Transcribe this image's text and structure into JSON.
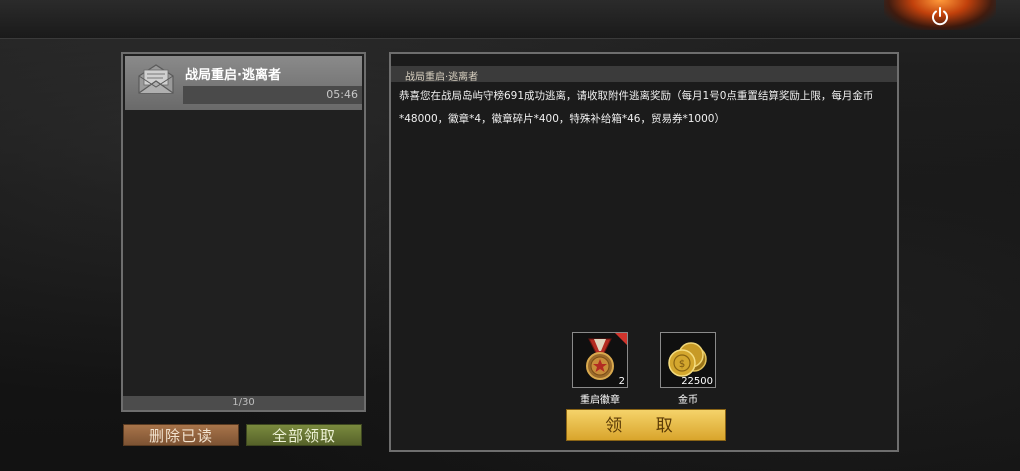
{
  "mail_list": {
    "items": [
      {
        "title": "战局重启·逃离者",
        "time": "05:46"
      }
    ],
    "page_indicator": "1/30"
  },
  "buttons": {
    "delete_read": "删除已读",
    "claim_all": "全部领取",
    "claim": "领 取"
  },
  "detail": {
    "title": "战局重启·逃离者",
    "body": "恭喜您在战局岛屿守榜691成功逃离，请收取附件逃离奖励（每月1号0点重置结算奖励上限，每月金币*48000，徽章*4，徽章碎片*400，特殊补给箱*46，贸易券*1000）",
    "rewards": [
      {
        "name": "重启徽章",
        "count": "2",
        "icon": "medal-icon",
        "flagged": true
      },
      {
        "name": "金币",
        "count": "22500",
        "icon": "gold-coins-icon",
        "flagged": false
      }
    ]
  },
  "colors": {
    "claim_button": "#e8bb45",
    "delete_button": "#956545",
    "claim_all_button": "#6b7934",
    "power_glow": "#e0631a"
  }
}
